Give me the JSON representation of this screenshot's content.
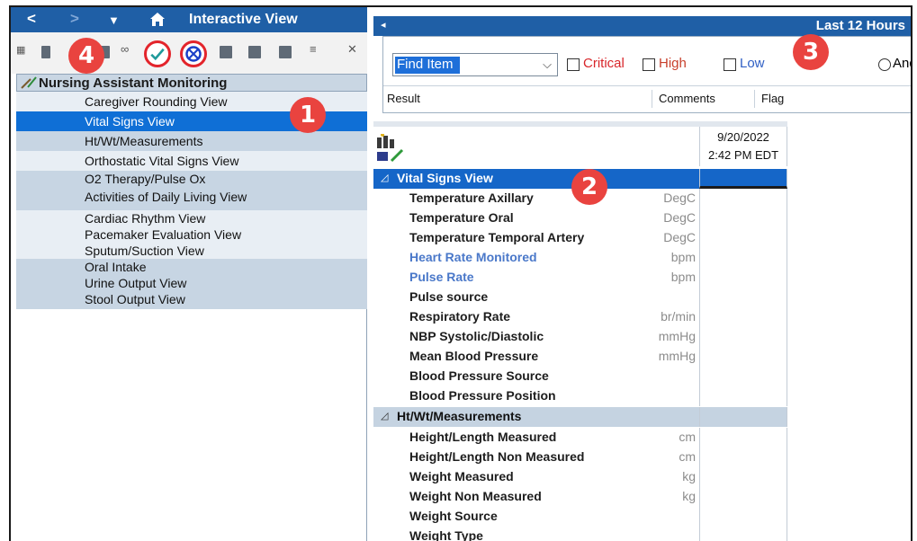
{
  "left": {
    "window_title": "Interactive View",
    "back_glyph": "<",
    "forward_glyph": ">",
    "dropdown_glyph": "▼",
    "band_title": "Nursing Assistant Monitoring",
    "views": [
      {
        "label": "Caregiver Rounding View"
      },
      {
        "label": "Vital Signs View"
      },
      {
        "label": "Ht/Wt/Measurements"
      },
      {
        "label": "Orthostatic Vital Signs View"
      },
      {
        "label": "O2 Therapy/Pulse Ox"
      },
      {
        "label": "Activities of Daily Living View"
      },
      {
        "label": "Cardiac Rhythm View"
      },
      {
        "label": "Pacemaker Evaluation View"
      },
      {
        "label": "Sputum/Suction View"
      },
      {
        "label": "Oral Intake"
      },
      {
        "label": "Urine Output View"
      },
      {
        "label": "Stool Output View"
      }
    ]
  },
  "annotations": {
    "b1": "1",
    "b2": "2",
    "b3": "3",
    "b4": "4"
  },
  "right": {
    "time_range": "Last 12 Hours",
    "find_item": "Find Item",
    "filters": {
      "critical": "Critical",
      "high": "High",
      "low": "Low",
      "and": "And"
    },
    "columns": {
      "result": "Result",
      "comments": "Comments",
      "flag": "Flag"
    },
    "date": "9/20/2022",
    "time": "2:42 PM EDT",
    "sections": {
      "vitals": "Vital Signs View",
      "measurements": "Ht/Wt/Measurements"
    },
    "vitals_rows": [
      {
        "name": "Temperature Axillary",
        "unit": "DegC"
      },
      {
        "name": "Temperature Oral",
        "unit": "DegC"
      },
      {
        "name": "Temperature Temporal Artery",
        "unit": "DegC"
      },
      {
        "name": "Heart Rate Monitored",
        "unit": "bpm"
      },
      {
        "name": "Pulse Rate",
        "unit": "bpm"
      },
      {
        "name": "Pulse source",
        "unit": ""
      },
      {
        "name": "Respiratory Rate",
        "unit": "br/min"
      },
      {
        "name": "NBP Systolic/Diastolic",
        "unit": "mmHg"
      },
      {
        "name": "Mean Blood Pressure",
        "unit": "mmHg"
      },
      {
        "name": "Blood Pressure Source",
        "unit": ""
      },
      {
        "name": "Blood Pressure Position",
        "unit": ""
      }
    ],
    "measure_rows": [
      {
        "name": "Height/Length Measured",
        "unit": "cm"
      },
      {
        "name": "Height/Length Non Measured",
        "unit": "cm"
      },
      {
        "name": "Weight Measured",
        "unit": "kg"
      },
      {
        "name": "Weight Non Measured",
        "unit": "kg"
      },
      {
        "name": "Weight Source",
        "unit": ""
      },
      {
        "name": "Weight Type",
        "unit": ""
      }
    ]
  },
  "colors": {
    "accent": "#1f5fa6",
    "badge": "#e9433f",
    "link": "#4a78c9"
  }
}
